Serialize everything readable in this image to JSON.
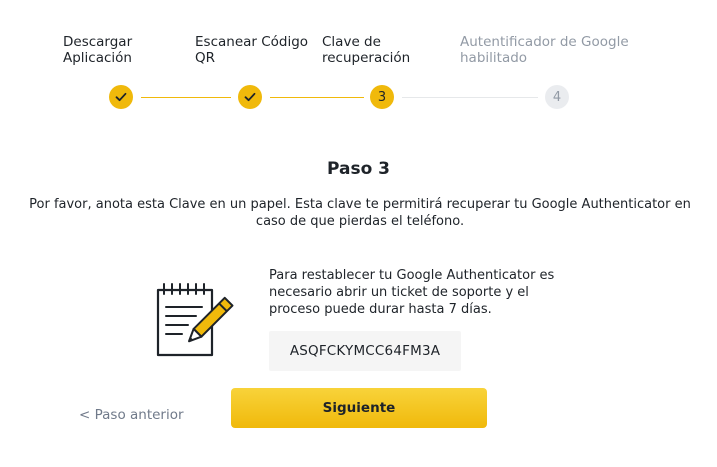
{
  "stepper": {
    "steps": [
      {
        "label": "Descargar\nAplicación",
        "state": "done",
        "number": "1"
      },
      {
        "label": "Escanear Código\nQR",
        "state": "done",
        "number": "2"
      },
      {
        "label": "Clave de\nrecuperación",
        "state": "current",
        "number": "3"
      },
      {
        "label": "Autentificador de Google\nhabilitado",
        "state": "todo",
        "number": "4"
      }
    ]
  },
  "main": {
    "title": "Paso 3",
    "instructions": "Por favor, anota esta Clave en un papel. Esta clave te permitirá recuperar tu Google Authenticator en caso de que pierdas el teléfono.",
    "icon": "notepad-pencil-icon",
    "info_text": "Para restablecer tu Google Authenticator es necesario abrir un ticket de soporte y el proceso puede durar hasta 7 días.",
    "recovery_key": "ASQFCKYMCC64FM3A"
  },
  "footer": {
    "back_label": "< Paso anterior",
    "next_label": "Siguiente"
  },
  "colors": {
    "accent": "#f0b90b",
    "inactive": "#eaecef",
    "text": "#1e2329",
    "muted": "#929aa5"
  }
}
